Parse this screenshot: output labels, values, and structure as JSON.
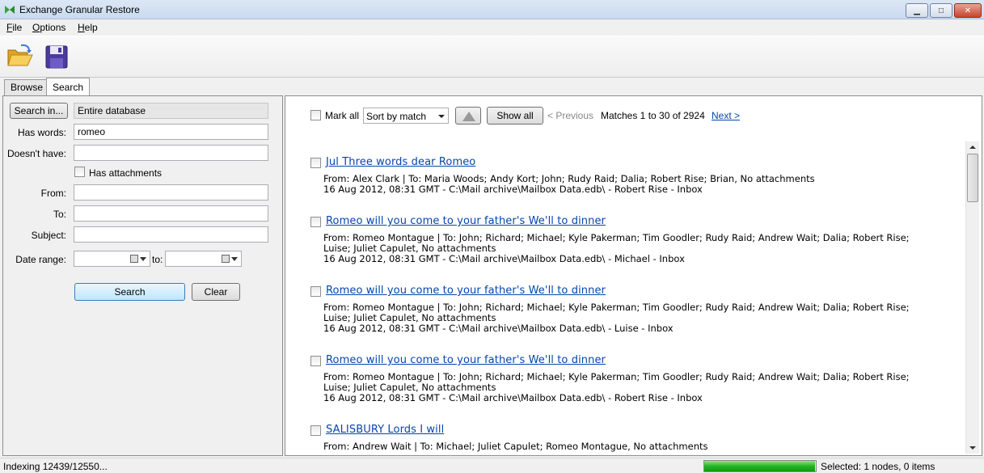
{
  "window": {
    "title": "Exchange Granular Restore"
  },
  "menu": {
    "items": [
      "File",
      "Options",
      "Help"
    ]
  },
  "toolbar": {
    "open_icon": "open-folder-icon",
    "save_icon": "save-disk-icon"
  },
  "tabs": [
    {
      "label": "Browse",
      "active": false
    },
    {
      "label": "Search",
      "active": true
    }
  ],
  "search_form": {
    "search_in_button": "Search in...",
    "search_in_value": "Entire database",
    "has_words_label": "Has words:",
    "has_words_value": "romeo",
    "doesnt_have_label": "Doesn't have:",
    "doesnt_have_value": "",
    "has_attachments_label": "Has attachments",
    "from_label": "From:",
    "to_label": "To:",
    "subject_label": "Subject:",
    "date_range_label": "Date range:",
    "date_to_label": "to:",
    "search_button": "Search",
    "clear_button": "Clear"
  },
  "results_toolbar": {
    "mark_all": "Mark all",
    "sort_value": "Sort by match",
    "show_all": "Show all",
    "previous": "< Previous",
    "matches": "Matches 1 to 30 of 2924",
    "next": "Next >"
  },
  "results": [
    {
      "subject": "Jul Three words dear Romeo",
      "line1": "From: Alex Clark | To: Maria Woods; Andy Kort; John; Rudy Raid; Dalia; Robert Rise; Brian, No attachments",
      "line2": "",
      "line3": "16 Aug 2012, 08:31 GMT - C:\\Mail archive\\Mailbox Data.edb\\ - Robert Rise - Inbox"
    },
    {
      "subject": "Romeo will you come to your father's We'll to dinner",
      "line1": "From: Romeo Montague | To: John; Richard; Michael; Kyle Pakerman; Tim Goodler; Rudy Raid; Andrew Wait; Dalia; Robert Rise;",
      "line2": "Luise; Juliet Capulet, No attachments",
      "line3": "16 Aug 2012, 08:31 GMT - C:\\Mail archive\\Mailbox Data.edb\\ - Michael - Inbox"
    },
    {
      "subject": "Romeo will you come to your father's We'll to dinner",
      "line1": "From: Romeo Montague | To: John; Richard; Michael; Kyle Pakerman; Tim Goodler; Rudy Raid; Andrew Wait; Dalia; Robert Rise;",
      "line2": "Luise; Juliet Capulet, No attachments",
      "line3": "16 Aug 2012, 08:31 GMT - C:\\Mail archive\\Mailbox Data.edb\\ - Luise - Inbox"
    },
    {
      "subject": "Romeo will you come to your father's We'll to dinner",
      "line1": "From: Romeo Montague | To: John; Richard; Michael; Kyle Pakerman; Tim Goodler; Rudy Raid; Andrew Wait; Dalia; Robert Rise;",
      "line2": "Luise; Juliet Capulet, No attachments",
      "line3": "16 Aug 2012, 08:31 GMT - C:\\Mail archive\\Mailbox Data.edb\\ - Robert Rise - Inbox"
    },
    {
      "subject": "SALISBURY Lords I will",
      "line1": "From: Andrew Wait | To: Michael; Juliet Capulet; Romeo Montague, No attachments",
      "line2": "",
      "line3": ""
    }
  ],
  "status": {
    "indexing": "Indexing 12439/12550...",
    "progress_fraction": 0.99,
    "selected": "Selected: 1 nodes, 0 items"
  },
  "colors": {
    "link": "#0645ad",
    "progress": "#1fb81f",
    "titlebar": "#c9dbef"
  }
}
